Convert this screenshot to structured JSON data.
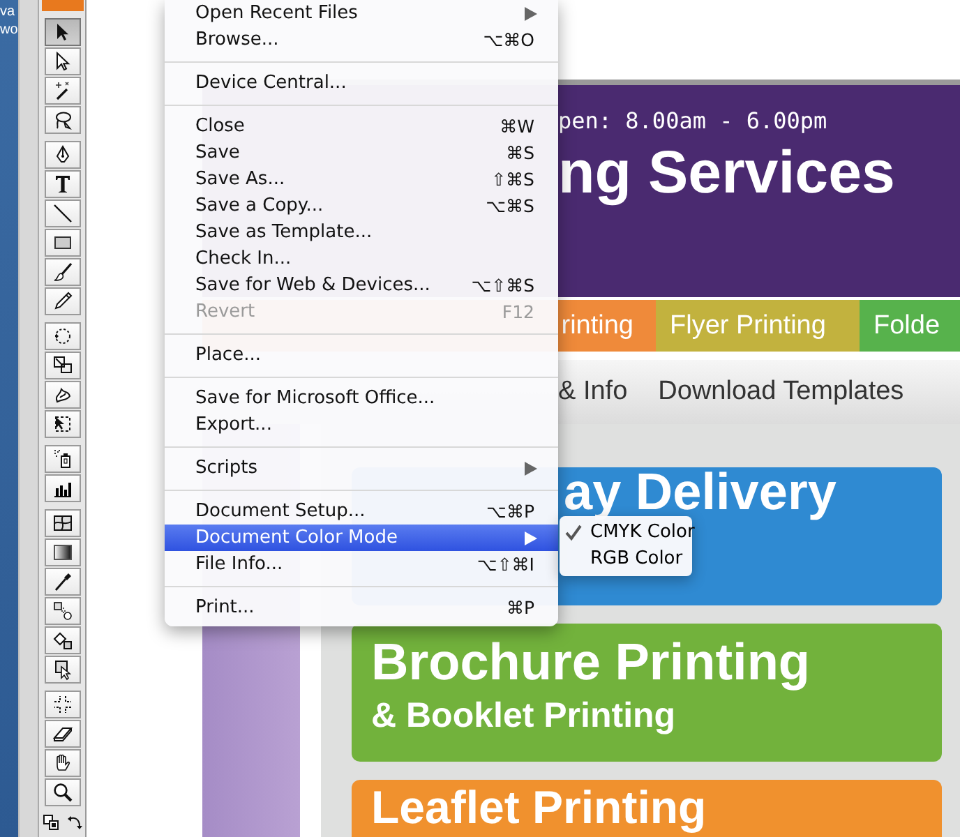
{
  "desktop": {
    "labels": [
      "va",
      "wo"
    ]
  },
  "toolbox": {
    "groups": [
      {
        "tools": [
          {
            "kind": "selection",
            "selected": true
          },
          {
            "kind": "direct-selection",
            "selected": false
          },
          {
            "kind": "magic-wand",
            "selected": false
          },
          {
            "kind": "lasso",
            "selected": false
          }
        ]
      },
      {
        "tools": [
          {
            "kind": "pen",
            "selected": false
          },
          {
            "kind": "type",
            "selected": false
          },
          {
            "kind": "line",
            "selected": false
          },
          {
            "kind": "rectangle",
            "selected": false
          },
          {
            "kind": "paintbrush",
            "selected": false
          },
          {
            "kind": "pencil",
            "selected": false
          }
        ]
      },
      {
        "tools": [
          {
            "kind": "rotate",
            "selected": false
          },
          {
            "kind": "scale",
            "selected": false
          },
          {
            "kind": "warp",
            "selected": false
          },
          {
            "kind": "free-transform",
            "selected": false
          }
        ]
      },
      {
        "tools": [
          {
            "kind": "symbol-sprayer",
            "selected": false
          },
          {
            "kind": "column-graph",
            "selected": false
          }
        ]
      },
      {
        "tools": [
          {
            "kind": "mesh",
            "selected": false
          },
          {
            "kind": "gradient",
            "selected": false
          },
          {
            "kind": "eyedropper",
            "selected": false
          },
          {
            "kind": "blend",
            "selected": false
          },
          {
            "kind": "live-paint-bucket",
            "selected": false
          },
          {
            "kind": "live-paint-selection",
            "selected": false
          }
        ]
      },
      {
        "tools": [
          {
            "kind": "slice",
            "selected": false
          },
          {
            "kind": "eraser",
            "selected": false
          },
          {
            "kind": "hand",
            "selected": false
          },
          {
            "kind": "zoom",
            "selected": false
          }
        ]
      }
    ]
  },
  "web_page": {
    "hours": "pen: 8.00am - 6.00pm",
    "title": "ng Services",
    "nav": [
      {
        "label": "rinting",
        "color": "#ef8a3a"
      },
      {
        "label": "Flyer Printing",
        "color": "#c2b23e"
      },
      {
        "label": "Folde",
        "color": "#57b24c"
      }
    ],
    "subnav": [
      "& Info",
      "Download Templates"
    ],
    "banners": [
      {
        "title": "ay Delivery",
        "color": "#2f8ad2"
      },
      {
        "title": "Brochure Printing",
        "subtitle": "& Booklet Printing",
        "color": "#72b23c"
      },
      {
        "title": "Leaflet Printing",
        "color": "#f0912e"
      }
    ]
  },
  "file_menu": {
    "sections": [
      {
        "items": [
          {
            "label": "Open Recent Files",
            "has_submenu": true,
            "disabled": false,
            "selected": false
          },
          {
            "label": "Browse...",
            "shortcut": "⌥⌘O",
            "has_submenu": false,
            "disabled": false,
            "selected": false
          }
        ]
      },
      {
        "items": [
          {
            "label": "Device Central...",
            "has_submenu": false,
            "disabled": false,
            "selected": false
          }
        ]
      },
      {
        "items": [
          {
            "label": "Close",
            "shortcut": "⌘W",
            "has_submenu": false,
            "disabled": false,
            "selected": false
          },
          {
            "label": "Save",
            "shortcut": "⌘S",
            "has_submenu": false,
            "disabled": false,
            "selected": false
          },
          {
            "label": "Save As...",
            "shortcut": "⇧⌘S",
            "has_submenu": false,
            "disabled": false,
            "selected": false
          },
          {
            "label": "Save a Copy...",
            "shortcut": "⌥⌘S",
            "has_submenu": false,
            "disabled": false,
            "selected": false
          },
          {
            "label": "Save as Template...",
            "has_submenu": false,
            "disabled": false,
            "selected": false
          },
          {
            "label": "Check In...",
            "has_submenu": false,
            "disabled": false,
            "selected": false
          },
          {
            "label": "Save for Web & Devices...",
            "shortcut": "⌥⇧⌘S",
            "has_submenu": false,
            "disabled": false,
            "selected": false
          },
          {
            "label": "Revert",
            "shortcut": "F12",
            "has_submenu": false,
            "disabled": true,
            "selected": false
          }
        ]
      },
      {
        "items": [
          {
            "label": "Place...",
            "has_submenu": false,
            "disabled": false,
            "selected": false
          }
        ]
      },
      {
        "items": [
          {
            "label": "Save for Microsoft Office...",
            "has_submenu": false,
            "disabled": false,
            "selected": false
          },
          {
            "label": "Export...",
            "has_submenu": false,
            "disabled": false,
            "selected": false
          }
        ]
      },
      {
        "items": [
          {
            "label": "Scripts",
            "has_submenu": true,
            "disabled": false,
            "selected": false
          }
        ]
      },
      {
        "items": [
          {
            "label": "Document Setup...",
            "shortcut": "⌥⌘P",
            "has_submenu": false,
            "disabled": false,
            "selected": false
          },
          {
            "label": "Document Color Mode",
            "has_submenu": true,
            "disabled": false,
            "selected": true
          },
          {
            "label": "File Info...",
            "shortcut": "⌥⇧⌘I",
            "has_submenu": false,
            "disabled": false,
            "selected": false
          }
        ]
      },
      {
        "items": [
          {
            "label": "Print...",
            "shortcut": "⌘P",
            "has_submenu": false,
            "disabled": false,
            "selected": false
          }
        ]
      }
    ]
  },
  "color_mode_submenu": {
    "items": [
      {
        "label": "CMYK Color",
        "checked": true,
        "selected": false
      },
      {
        "label": "RGB Color",
        "checked": false,
        "selected": false
      }
    ]
  }
}
